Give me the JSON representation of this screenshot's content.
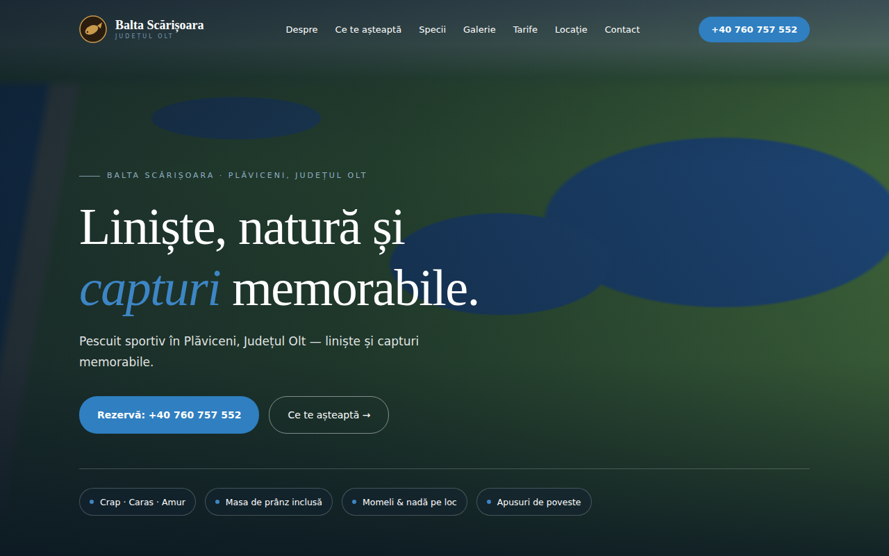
{
  "brand": {
    "name": "Balta Scărișoara",
    "tagline": "JUDEȚUL OLT"
  },
  "nav": [
    {
      "label": "Despre"
    },
    {
      "label": "Ce te așteaptă"
    },
    {
      "label": "Specii"
    },
    {
      "label": "Galerie"
    },
    {
      "label": "Tarife"
    },
    {
      "label": "Locație"
    },
    {
      "label": "Contact"
    }
  ],
  "nav_cta": "+40 760 757 552",
  "hero": {
    "eyebrow": "BALTA SCĂRIȘOARA · PLĂVICENI, JUDEȚUL OLT",
    "title_line1": "Liniște, natură și",
    "title_accent": "capturi",
    "title_rest": "memorabile.",
    "subtitle": "Pescuit sportiv în Plăviceni, Județul Olt — liniște și capturi memorabile.",
    "primary_button": "Rezervă: +40 760 757 552",
    "secondary_button": "Ce te așteaptă →"
  },
  "features": [
    "Crap · Caras · Amur",
    "Masa de prânz inclusă",
    "Momeli & nadă pe loc",
    "Apusuri de poveste"
  ]
}
